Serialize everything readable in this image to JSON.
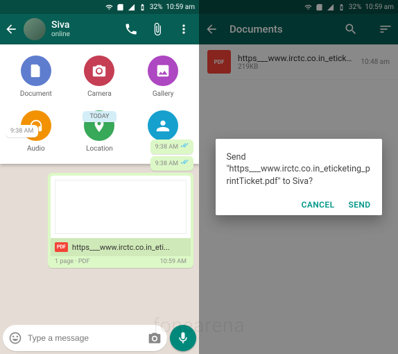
{
  "statusbar": {
    "battery": "32%",
    "time": "10:59 am"
  },
  "left": {
    "header": {
      "name": "Siva",
      "status": "online"
    },
    "attach": [
      {
        "label": "Document",
        "key": "doc"
      },
      {
        "label": "Camera",
        "key": "cam"
      },
      {
        "label": "Gallery",
        "key": "gal"
      },
      {
        "label": "Audio",
        "key": "aud"
      },
      {
        "label": "Location",
        "key": "loc"
      },
      {
        "label": "Contact",
        "key": "con"
      }
    ],
    "chat": {
      "date_label": "TODAY",
      "in1_time": "9:38 AM",
      "out1_time": "9:38 AM",
      "out2_time": "9:38 AM",
      "doc": {
        "filename": "https___www.irctc.co.in_eti...",
        "pages": "1 page · PDF",
        "time": "10:59 AM"
      }
    },
    "compose": {
      "placeholder": "Type a message"
    }
  },
  "right": {
    "header": {
      "title": "Documents"
    },
    "list": [
      {
        "name": "https___www.irctc.co.in_eticketing_p...",
        "size": "219KB",
        "time": "10:48 am"
      }
    ],
    "dialog": {
      "message": "Send \"https___www.irctc.co.in_eticketing_printTicket.pdf\" to Siva?",
      "cancel": "CANCEL",
      "send": "SEND"
    }
  },
  "watermark": "fonearena"
}
